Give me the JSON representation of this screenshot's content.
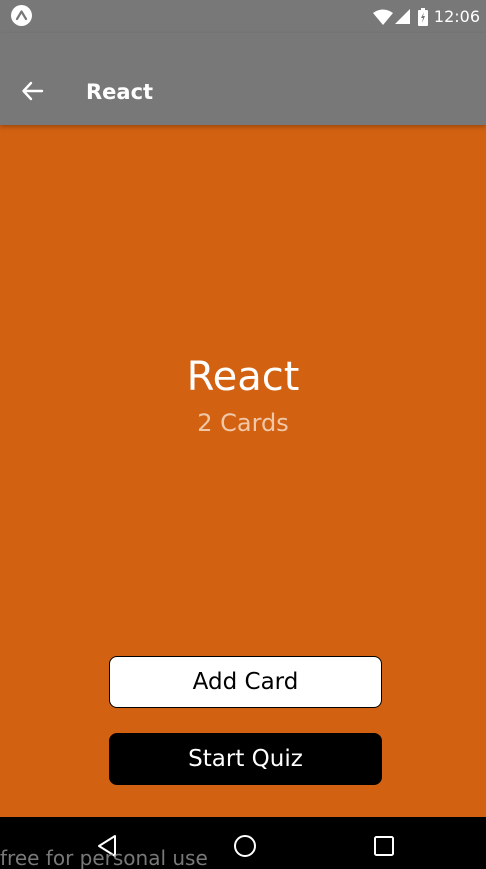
{
  "status_bar": {
    "time": "12:06",
    "icons": [
      "expo-icon",
      "wifi-icon",
      "cellular-signal-icon",
      "battery-icon"
    ]
  },
  "app_bar": {
    "back_icon": "arrow-left-icon",
    "title": "React"
  },
  "deck": {
    "title": "React",
    "card_count": "2 Cards"
  },
  "actions": {
    "add_card_label": "Add Card",
    "start_quiz_label": "Start Quiz"
  },
  "nav_bar": {
    "icons": [
      "nav-back-icon",
      "nav-home-icon",
      "nav-recents-icon"
    ]
  },
  "watermark": "free for personal use",
  "colors": {
    "background": "#d26112",
    "app_bar": "#787878",
    "card_count_text": "#f0c8a8",
    "quiz_button": "#000000",
    "add_button": "#ffffff"
  }
}
